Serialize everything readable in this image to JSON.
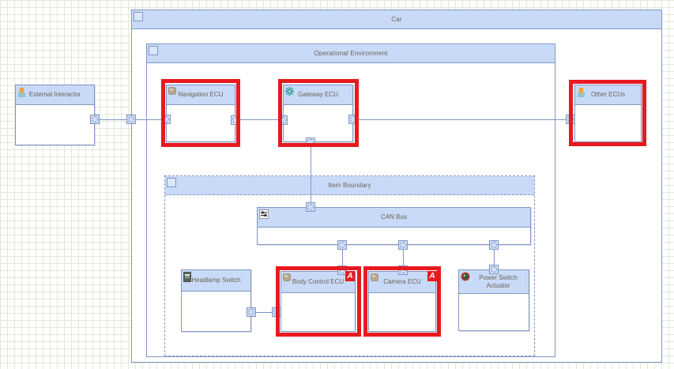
{
  "colors": {
    "header-fill": "#c8daf8",
    "border": "#8296c6",
    "line": "#8096c5",
    "label": "#6e6152",
    "grid": "#e2e8d8",
    "port-fill": "#cfdef6",
    "highlight": "#e8191f"
  },
  "diagram": {
    "containers": {
      "car": {
        "label": "Car"
      },
      "operational_environment": {
        "label": "Operational Environment"
      },
      "item_boundary": {
        "label": "Item Boundary"
      }
    },
    "blocks": {
      "external_interactor": {
        "label": "External Interactor",
        "icon": "person-icon",
        "highlighted": false
      },
      "navigation_ecu": {
        "label": "Navigation ECU",
        "icon": "component-icon",
        "highlighted": true
      },
      "gateway_ecu": {
        "label": "Gateway ECU",
        "icon": "gear-icon",
        "highlighted": true
      },
      "other_ecus": {
        "label": "Other ECUs",
        "icon": "person-icon",
        "highlighted": true
      },
      "can_bus": {
        "label": "CAN Bus",
        "icon": "bus-icon",
        "highlighted": false
      },
      "headlamp_switch": {
        "label": "Headlamp Switch",
        "icon": "switch-icon",
        "highlighted": false
      },
      "body_control_ecu": {
        "label": "Body Control ECU",
        "icon": "component-icon",
        "highlighted": true,
        "marker": "A"
      },
      "camera_ecu": {
        "label": "Camera ECU",
        "icon": "component-icon",
        "highlighted": true,
        "marker": "A"
      },
      "power_switch_actuator": {
        "label": "Power Switch Actuator",
        "icon": "actuator-icon",
        "highlighted": false
      }
    }
  }
}
